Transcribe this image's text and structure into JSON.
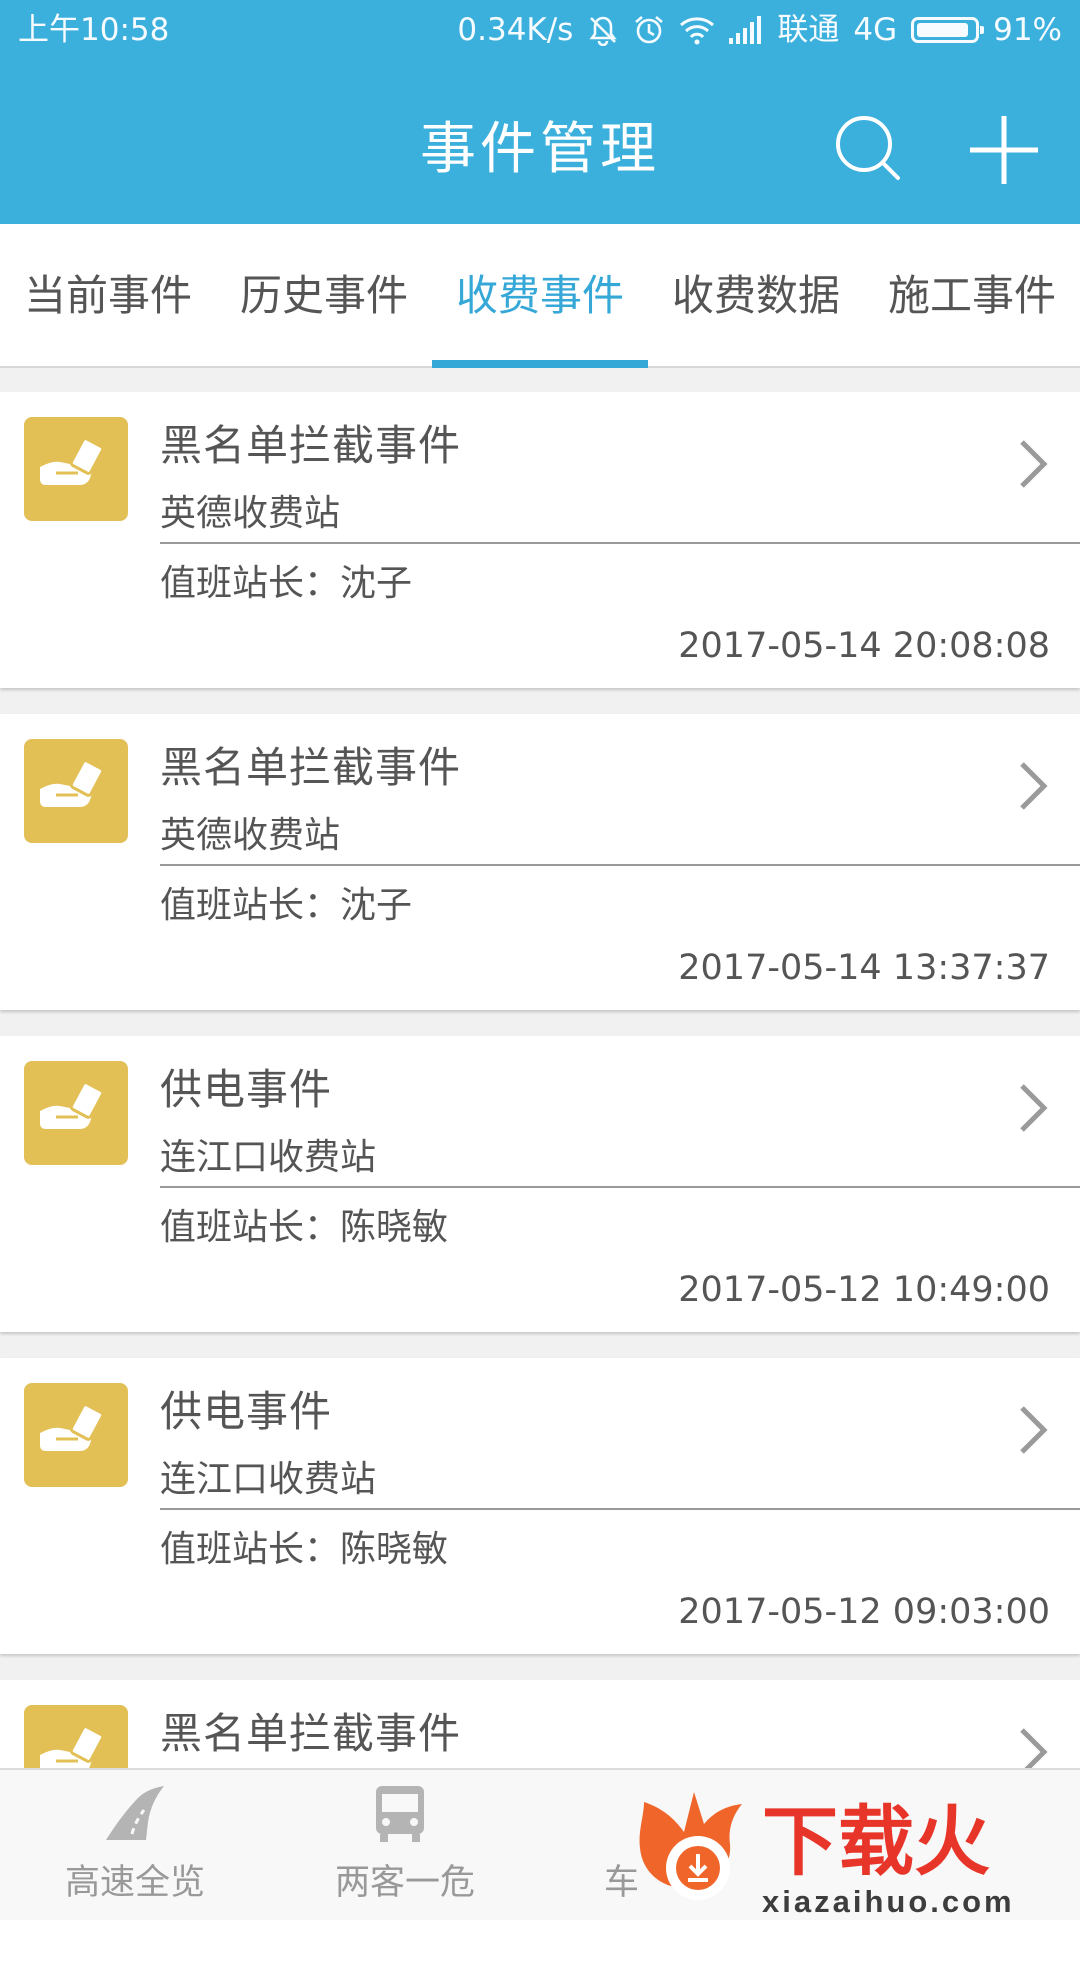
{
  "status_bar": {
    "time": "上午10:58",
    "speed": "0.34K/s",
    "carrier": "联通",
    "network": "4G",
    "battery": "91%",
    "battery_level": 0.91,
    "icons": [
      "mute-icon",
      "alarm-icon",
      "wifi-icon",
      "signal-icon",
      "battery-icon"
    ]
  },
  "header": {
    "title": "事件管理",
    "actions": [
      "search-icon",
      "add-icon"
    ]
  },
  "tabs": [
    {
      "label": "当前事件",
      "active": false
    },
    {
      "label": "历史事件",
      "active": false
    },
    {
      "label": "收费事件",
      "active": true
    },
    {
      "label": "收费数据",
      "active": false
    },
    {
      "label": "施工事件",
      "active": false
    }
  ],
  "events": [
    {
      "name": "黑名单拦截事件",
      "station": "英德收费站",
      "leader": "值班站长：沈子",
      "time": "2017-05-14 20:08:08"
    },
    {
      "name": "黑名单拦截事件",
      "station": "英德收费站",
      "leader": "值班站长：沈子",
      "time": "2017-05-14 13:37:37"
    },
    {
      "name": "供电事件",
      "station": "连江口收费站",
      "leader": "值班站长：陈晓敏",
      "time": "2017-05-12 10:49:00"
    },
    {
      "name": "供电事件",
      "station": "连江口收费站",
      "leader": "值班站长：陈晓敏",
      "time": "2017-05-12 09:03:00"
    },
    {
      "name": "黑名单拦截事件",
      "station": "",
      "leader": "",
      "time": ""
    }
  ],
  "bottom_nav": [
    {
      "label": "高速全览",
      "icon": "road-icon"
    },
    {
      "label": "两客一危",
      "icon": "bus-icon"
    },
    {
      "label": "车",
      "icon": "car-icon"
    }
  ],
  "watermark": {
    "text": "下载火",
    "url": "xiazaihuo.com"
  },
  "colors": {
    "primary": "#3cb0dc",
    "tab_active": "#36a8d8",
    "icon_bg": "#e2c056"
  }
}
